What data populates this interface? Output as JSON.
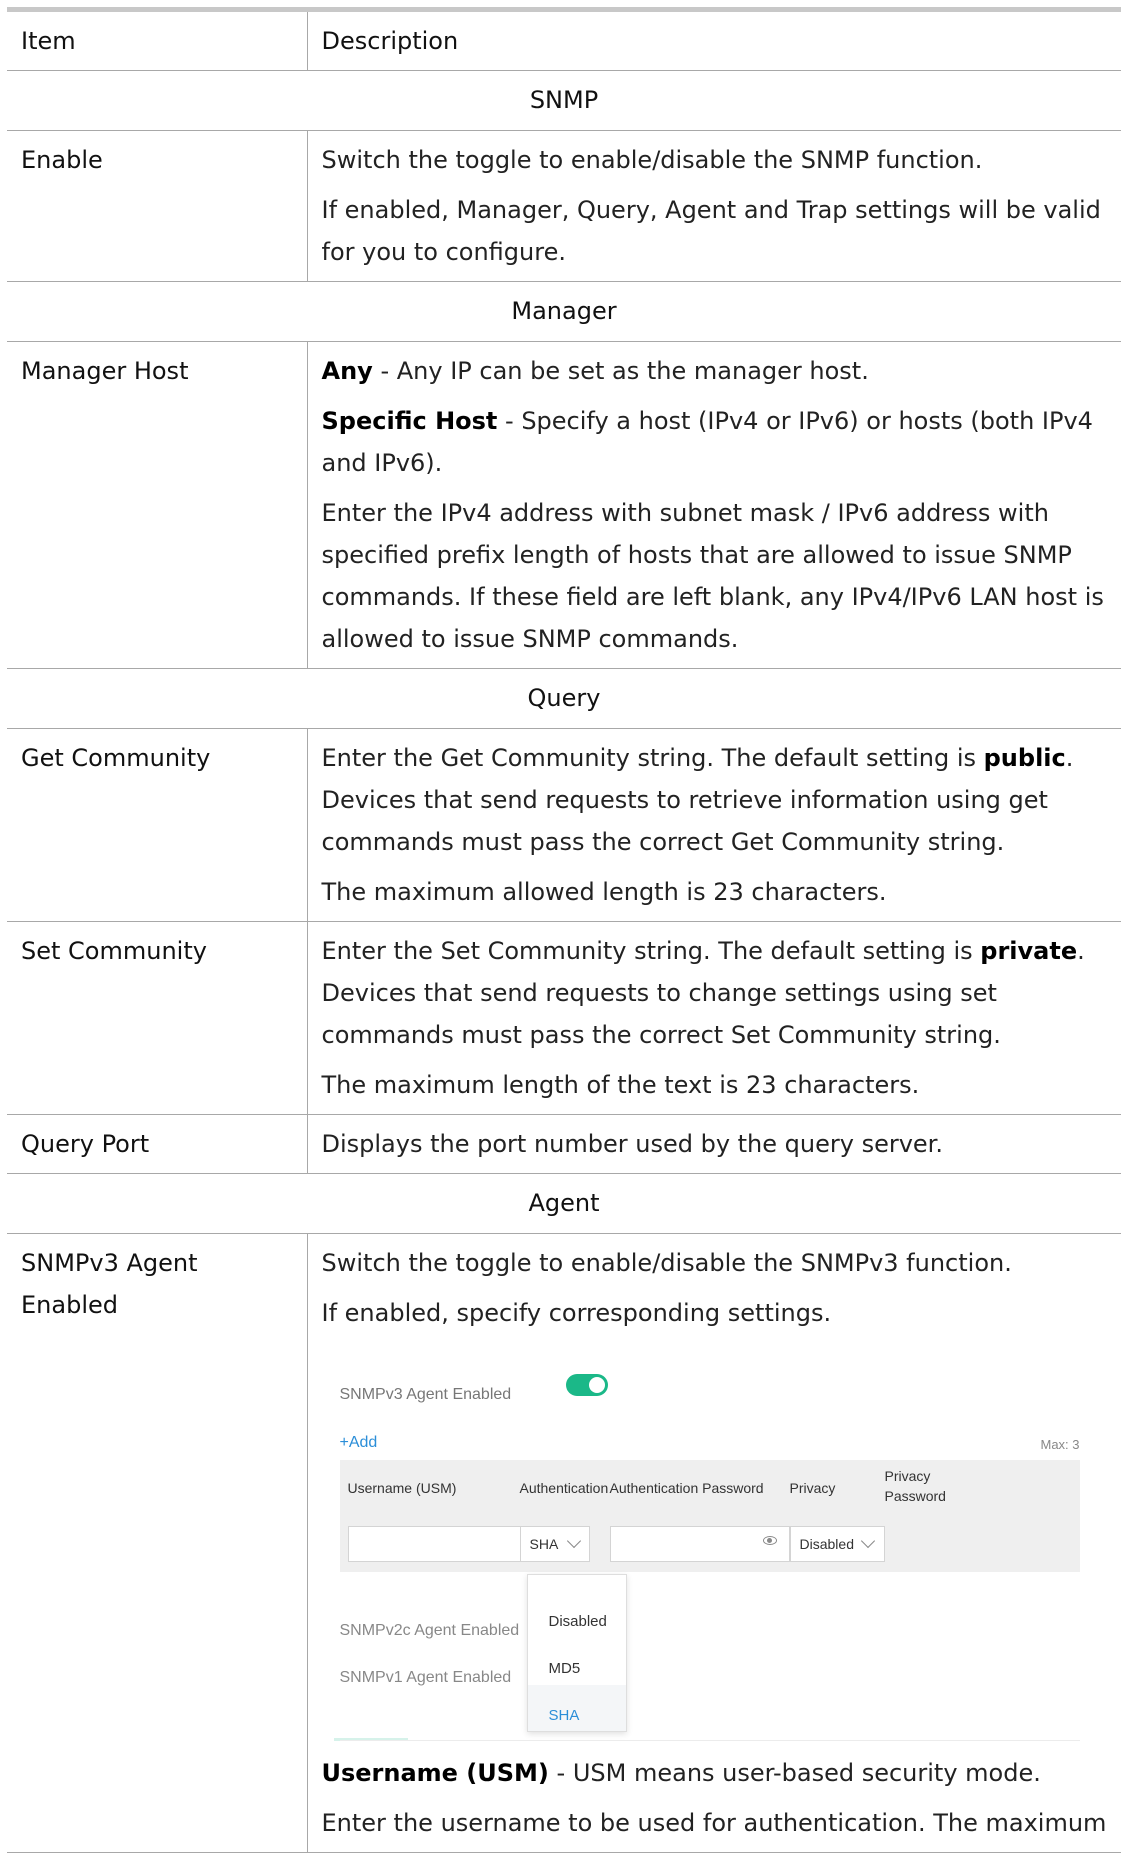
{
  "header": {
    "col_item": "Item",
    "col_desc": "Description"
  },
  "sections": {
    "snmp": "SNMP",
    "manager": "Manager",
    "query": "Query",
    "agent": "Agent"
  },
  "rows": {
    "enable": {
      "item": "Enable",
      "p1": "Switch the toggle to enable/disable the SNMP function.",
      "p2": "If enabled, Manager, Query, Agent and Trap settings will be valid for you to configure."
    },
    "manager_host": {
      "item": "Manager Host",
      "any_label": "Any",
      "any_text": " - Any IP can be set as the manager host.",
      "specific_label": "Specific Host",
      "specific_text": " - Specify a host (IPv4 or IPv6) or hosts (both IPv4 and IPv6).",
      "p3": "Enter the IPv4 address with subnet mask / IPv6 address with specified prefix length of hosts that are allowed to issue SNMP commands. If these field are left blank, any IPv4/IPv6 LAN host is allowed to issue SNMP commands."
    },
    "get_community": {
      "item": "Get Community",
      "p1a": "Enter the Get Community string. The default setting is ",
      "p1b": "public",
      "p1c": ". Devices that send requests to retrieve information using get commands must pass the correct Get Community string.",
      "p2": "The maximum allowed length is 23 characters."
    },
    "set_community": {
      "item": "Set Community",
      "p1a": "Enter the Set Community string. The default setting is ",
      "p1b": "private",
      "p1c": ". Devices that send requests to change settings using set commands must pass the correct Set Community string.",
      "p2": "The maximum length of the text is 23 characters."
    },
    "query_port": {
      "item": "Query Port",
      "p1": "Displays the port number used by the query server."
    },
    "snmpv3": {
      "item": "SNMPv3 Agent Enabled",
      "p1": "Switch the toggle to enable/disable the SNMPv3 function.",
      "p2": "If enabled, specify corresponding settings.",
      "usm_label": "Username (USM)",
      "usm_text": " - USM means user-based security mode.",
      "p4": "Enter the username to be used for authentication. The maximum"
    }
  },
  "screenshot": {
    "v3_label": "SNMPv3 Agent Enabled",
    "toggle_on": true,
    "toggle_color": "#1bb888",
    "add_label": "+Add",
    "max_label": "Max: 3",
    "columns": [
      "Username (USM)",
      "Authentication",
      "Authentication Password",
      "Privacy",
      "Privacy Password"
    ],
    "auth_value": "SHA",
    "privacy_value": "Disabled",
    "v2c_label": "SNMPv2c Agent Enabled",
    "v1_label": "SNMPv1 Agent Enabled",
    "auth_options": [
      "Disabled",
      "MD5",
      "SHA"
    ],
    "auth_selected": "SHA",
    "accent_color": "#2b8ed8"
  }
}
